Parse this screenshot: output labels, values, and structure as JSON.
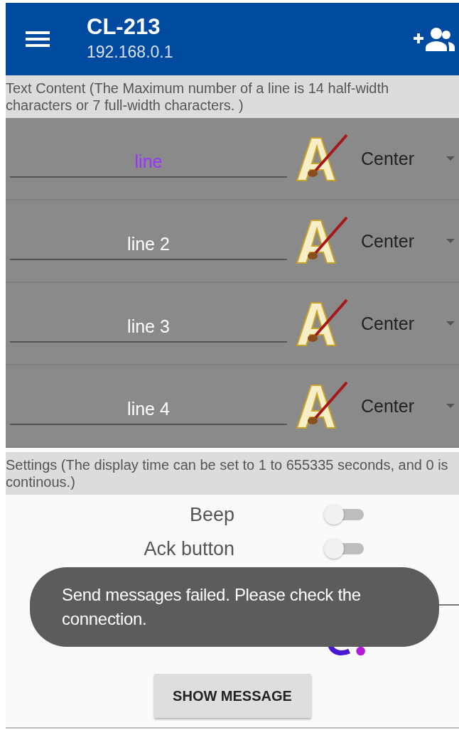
{
  "app_bar": {
    "title": "CL-213",
    "subtitle": "192.168.0.1"
  },
  "text_content_header": "Text Content (The Maximum number of a line is 14 half-width characters or 7 full-width characters. )",
  "lines": [
    {
      "value": "line",
      "color": "#9933ff",
      "alignment": "Center"
    },
    {
      "value": "line 2",
      "color": "#ffffff",
      "alignment": "Center"
    },
    {
      "value": "line 3",
      "color": "#ffffff",
      "alignment": "Center"
    },
    {
      "value": "line 4",
      "color": "#ffffff",
      "alignment": "Center"
    }
  ],
  "settings_header": "Settings (The display time can be set to 1 to 655335 seconds, and 0 is continous.)",
  "switches": [
    {
      "label": "Beep",
      "on": false
    },
    {
      "label": "Ack button",
      "on": false
    }
  ],
  "button": "SHOW MESSAGE",
  "toast": "Send messages failed. Please check the connection."
}
